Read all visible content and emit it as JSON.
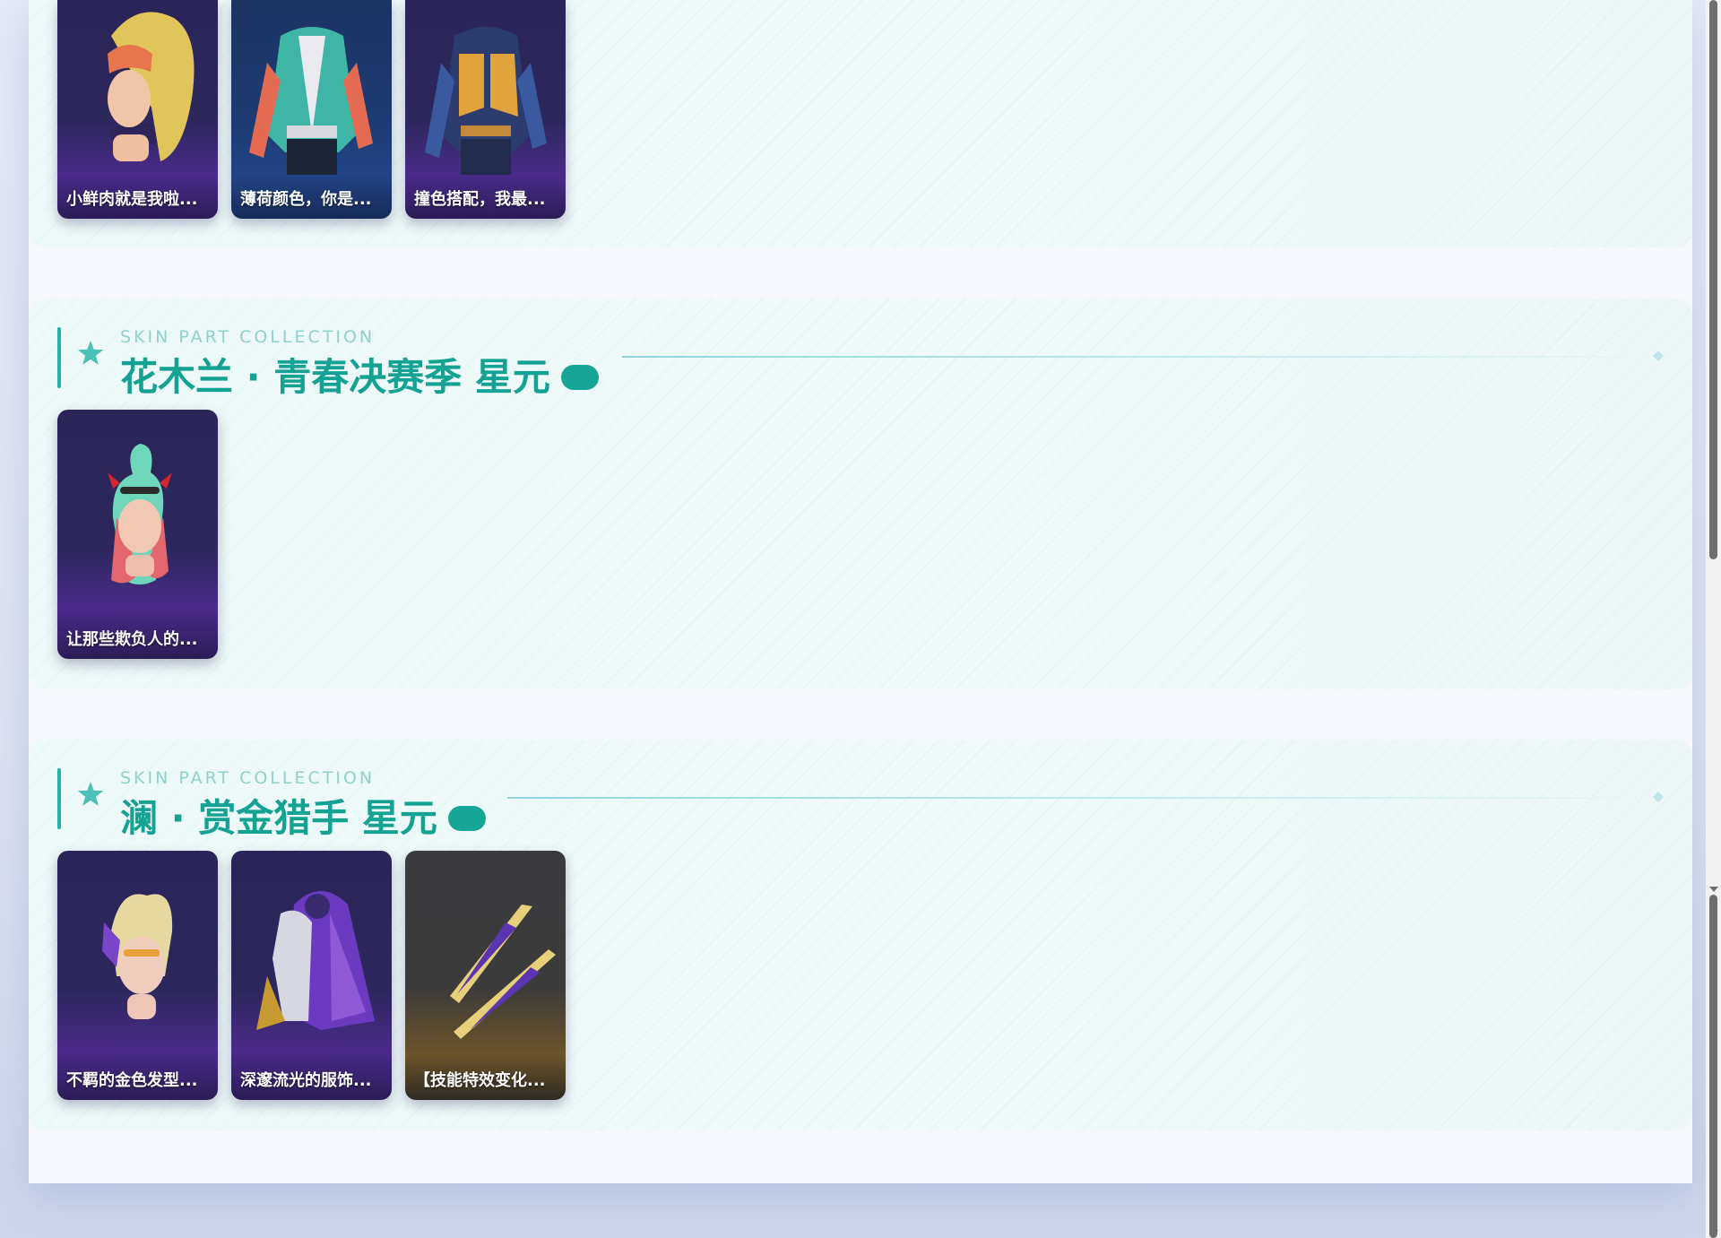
{
  "colors": {
    "accent": "#14a293",
    "subtitle": "#8fd3cc",
    "card_purple": "#2a2459",
    "card_blue": "#1d3464",
    "card_dark": "#3a3a3c"
  },
  "sections": [
    {
      "id": "top",
      "cards": [
        {
          "label": "小鲜肉就是我啦...",
          "art": "hero-head-icon"
        },
        {
          "label": "薄荷颜色，你是...",
          "art": "outfit-icon"
        },
        {
          "label": "撞色搭配，我最...",
          "art": "outfit-icon"
        }
      ]
    },
    {
      "id": "mulan",
      "subtitle": "SKIN PART COLLECTION",
      "title": "花木兰 · 青春决赛季 星元",
      "cards": [
        {
          "label": "让那些欺负人的...",
          "art": "hero-head-icon"
        }
      ]
    },
    {
      "id": "lan",
      "subtitle": "SKIN PART COLLECTION",
      "title": "澜 · 赏金猎手 星元",
      "cards": [
        {
          "label": "不羁的金色发型...",
          "art": "hero-head-icon"
        },
        {
          "label": "深邃流光的服饰...",
          "art": "outfit-icon"
        },
        {
          "label": "【技能特效变化...",
          "art": "blade-icon"
        }
      ]
    }
  ]
}
